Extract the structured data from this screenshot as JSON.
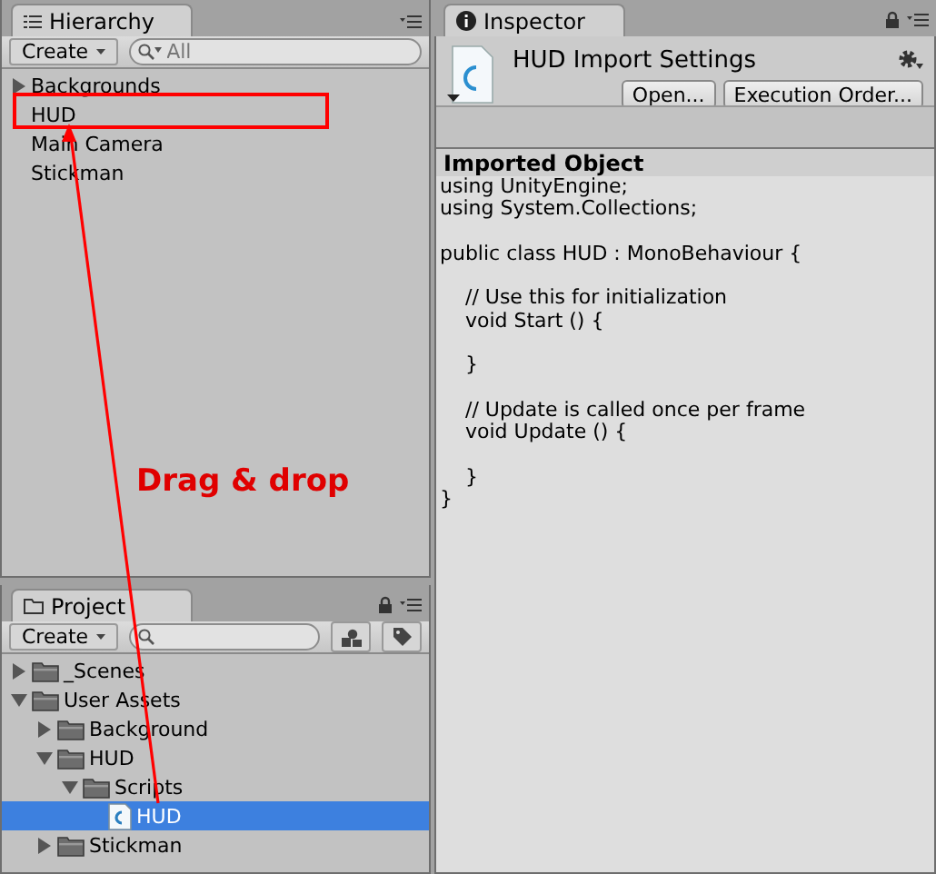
{
  "hierarchy": {
    "tab": "Hierarchy",
    "create_button": "Create",
    "search": {
      "placeholder": "All"
    },
    "items": [
      {
        "label": "Backgrounds",
        "expanded": false,
        "selected": false
      },
      {
        "label": "HUD",
        "selected": false
      },
      {
        "label": "Main Camera",
        "selected": false
      },
      {
        "label": "Stickman",
        "selected": false
      }
    ]
  },
  "project": {
    "tab": "Project",
    "create_button": "Create",
    "items": [
      {
        "label": "_Scenes",
        "kind": "folder",
        "expanded": false,
        "selected": false
      },
      {
        "label": "User Assets",
        "kind": "folder",
        "expanded": true,
        "selected": false,
        "children": [
          {
            "label": "Background",
            "kind": "folder",
            "expanded": false,
            "selected": false
          },
          {
            "label": "HUD",
            "kind": "folder",
            "expanded": true,
            "selected": false,
            "children": [
              {
                "label": "Scripts",
                "kind": "folder",
                "expanded": true,
                "selected": false,
                "children": [
                  {
                    "label": "HUD",
                    "kind": "script",
                    "selected": true
                  }
                ]
              }
            ]
          },
          {
            "label": "Stickman",
            "kind": "folder",
            "expanded": false,
            "selected": false
          }
        ]
      }
    ]
  },
  "inspector": {
    "tab": "Inspector",
    "title": "HUD Import Settings",
    "buttons": [
      "Open...",
      "Execution Order..."
    ],
    "section": "Imported Object",
    "code": "using UnityEngine;\nusing System.Collections;\n\npublic class HUD : MonoBehaviour {\n\n    // Use this for initialization\n    void Start () {\n\n    }\n\n    // Update is called once per frame\n    void Update () {\n\n    }\n}"
  },
  "annotation": {
    "text": "Drag & drop"
  }
}
